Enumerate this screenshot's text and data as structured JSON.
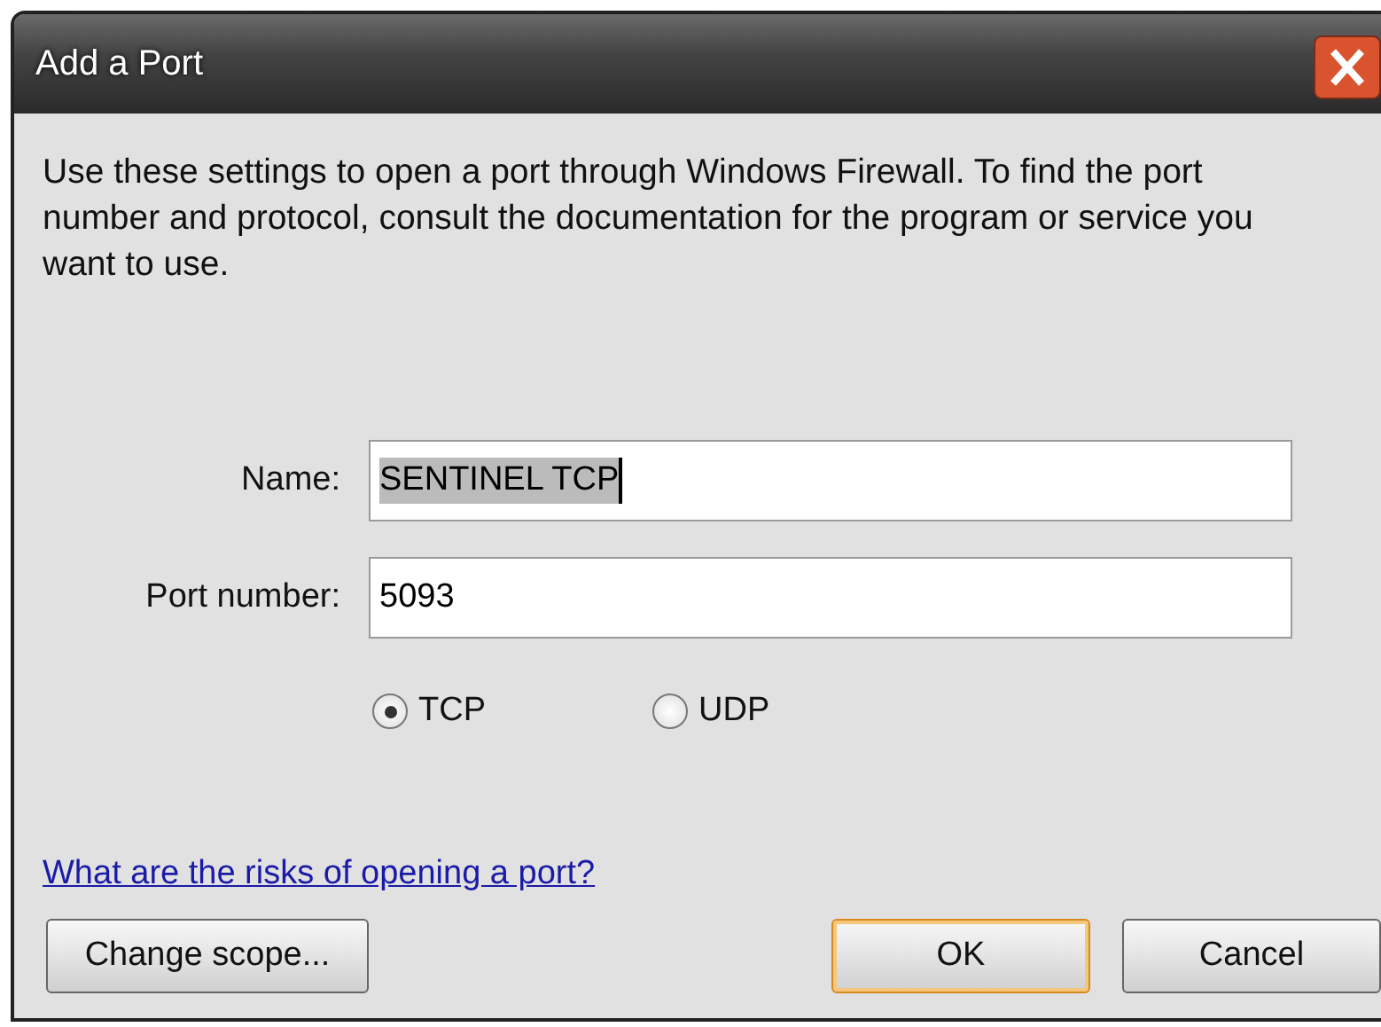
{
  "window": {
    "title": "Add a Port"
  },
  "description": "Use these settings to open a port through Windows Firewall. To find the port number and protocol, consult the documentation for the program or service you want to use.",
  "fields": [
    {
      "label": "Name:",
      "value": "SENTINEL TCP",
      "selected": true
    },
    {
      "label": "Port number:",
      "value": "5093",
      "selected": false
    }
  ],
  "protocols": [
    {
      "label": "TCP",
      "selected": true
    },
    {
      "label": "UDP",
      "selected": false
    }
  ],
  "link": "What are the risks of opening a port?",
  "buttons": [
    {
      "label": "Change scope...",
      "default": false
    },
    {
      "label": "OK",
      "default": true
    },
    {
      "label": "Cancel",
      "default": false
    }
  ]
}
